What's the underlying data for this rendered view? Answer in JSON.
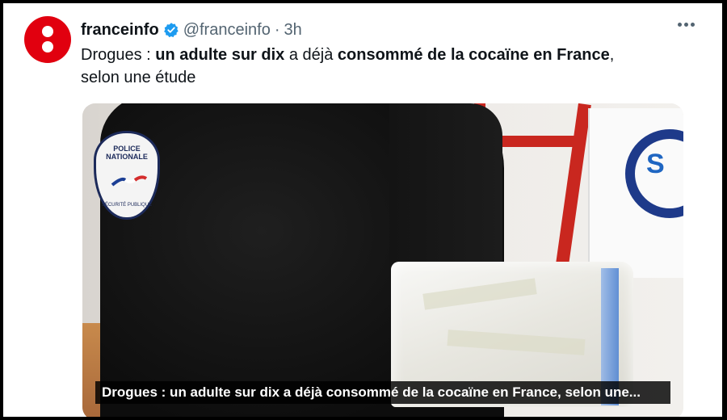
{
  "tweet": {
    "display_name": "franceinfo",
    "handle": "@franceinfo",
    "separator": "·",
    "time": "3h",
    "text_parts": [
      {
        "text": "Drogues : ",
        "bold": false
      },
      {
        "text": "un adulte sur dix",
        "bold": true
      },
      {
        "text": " a déjà ",
        "bold": false
      },
      {
        "text": "consommé de la cocaïne en France",
        "bold": true
      },
      {
        "text": ",",
        "bold": false
      },
      {
        "text": "selon une étude",
        "bold": false
      }
    ]
  },
  "media": {
    "caption": "Drogues : un adulte sur dix a déjà consommé de la cocaïne en France, selon une...",
    "patch_lines": [
      "POLICE",
      "NATIONALE"
    ],
    "patch_sub": "SÉCURITÉ PUBLIQUE",
    "sign_text": "S"
  },
  "colors": {
    "brand": "#e1000f",
    "verified": "#1d9bf0",
    "text_primary": "#0f1419",
    "text_secondary": "#536471"
  },
  "icons": {
    "avatar": "franceinfo-logo",
    "verified": "verified-badge-icon",
    "more": "more-icon"
  }
}
